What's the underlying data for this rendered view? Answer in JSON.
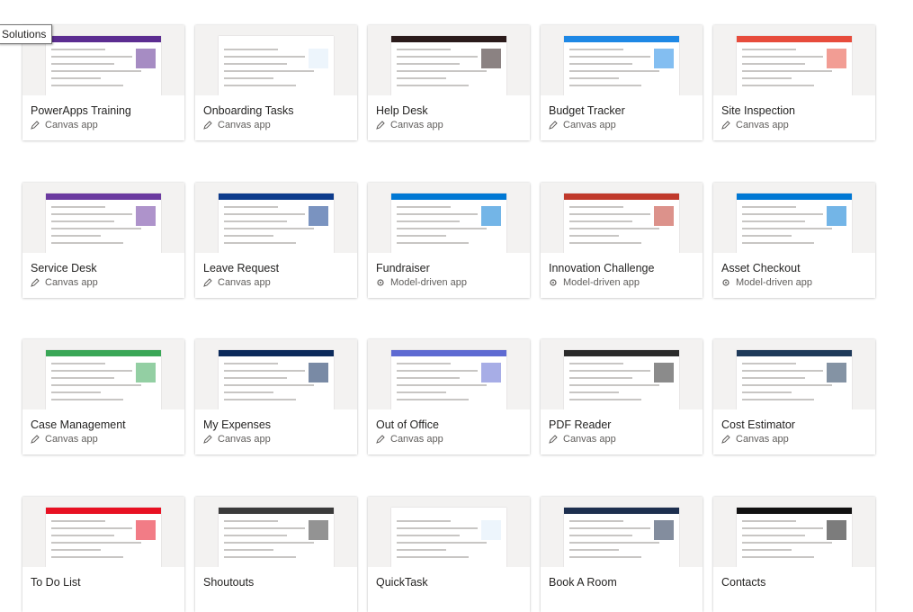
{
  "tooltip": "Solutions",
  "apps": [
    {
      "name": "PowerApps Training",
      "type": "Canvas app",
      "kind": "canvas",
      "accent": "#5c2d91"
    },
    {
      "name": "Onboarding Tasks",
      "type": "Canvas app",
      "kind": "canvas",
      "accent": "#ffffff"
    },
    {
      "name": "Help Desk",
      "type": "Canvas app",
      "kind": "canvas",
      "accent": "#2b1b1b"
    },
    {
      "name": "Budget Tracker",
      "type": "Canvas app",
      "kind": "canvas",
      "accent": "#1e88e5"
    },
    {
      "name": "Site Inspection",
      "type": "Canvas app",
      "kind": "canvas",
      "accent": "#e74c3c"
    },
    {
      "name": "Service Desk",
      "type": "Canvas app",
      "kind": "canvas",
      "accent": "#6b3aa0"
    },
    {
      "name": "Leave Request",
      "type": "Canvas app",
      "kind": "canvas",
      "accent": "#0d3b8c"
    },
    {
      "name": "Fundraiser",
      "type": "Model-driven app",
      "kind": "model",
      "accent": "#0078d4"
    },
    {
      "name": "Innovation Challenge",
      "type": "Model-driven app",
      "kind": "model",
      "accent": "#c0392b"
    },
    {
      "name": "Asset Checkout",
      "type": "Model-driven app",
      "kind": "model",
      "accent": "#0078d4"
    },
    {
      "name": "Case Management",
      "type": "Canvas app",
      "kind": "canvas",
      "accent": "#3aa757"
    },
    {
      "name": "My Expenses",
      "type": "Canvas app",
      "kind": "canvas",
      "accent": "#0b2a5b"
    },
    {
      "name": "Out of Office",
      "type": "Canvas app",
      "kind": "canvas",
      "accent": "#5e6ad2"
    },
    {
      "name": "PDF Reader",
      "type": "Canvas app",
      "kind": "canvas",
      "accent": "#2b2b2b"
    },
    {
      "name": "Cost Estimator",
      "type": "Canvas app",
      "kind": "canvas",
      "accent": "#1f3a5a"
    },
    {
      "name": "To Do List",
      "type": "",
      "kind": "canvas",
      "accent": "#e81123"
    },
    {
      "name": "Shoutouts",
      "type": "",
      "kind": "canvas",
      "accent": "#3b3b3b"
    },
    {
      "name": "QuickTask",
      "type": "",
      "kind": "canvas",
      "accent": "#ffffff"
    },
    {
      "name": "Book A Room",
      "type": "",
      "kind": "canvas",
      "accent": "#1d2f4f"
    },
    {
      "name": "Contacts",
      "type": "",
      "kind": "canvas",
      "accent": "#111111"
    }
  ]
}
